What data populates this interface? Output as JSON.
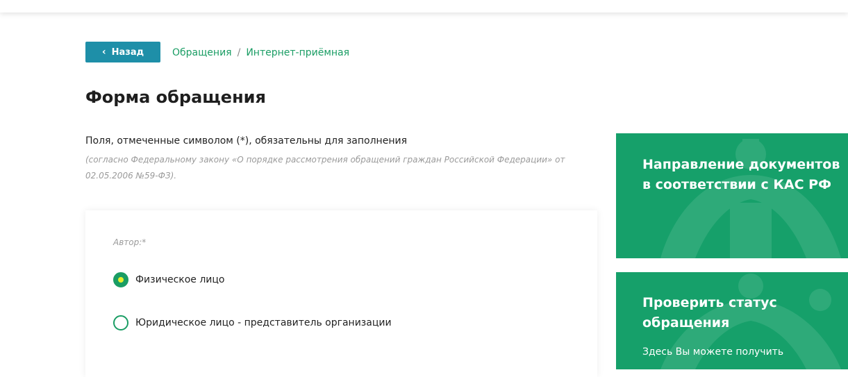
{
  "header": {},
  "nav": {
    "back_label": "Назад",
    "breadcrumb": [
      "Обращения",
      "Интернет-приёмная"
    ],
    "breadcrumb_separator": "/"
  },
  "page": {
    "title": "Форма обращения",
    "required_note": "Поля, отмеченные символом (*), обязательны для заполнения",
    "law_note": "(согласно Федеральному закону «О порядке рассмотрения обращений граждан Российской Федерации» от 02.05.2006 №59-ФЗ)."
  },
  "form": {
    "author_label": "Автор:*",
    "author_options": [
      {
        "label": "Физическое лицо",
        "checked": true
      },
      {
        "label": "Юридическое лицо - представитель организации",
        "checked": false
      }
    ]
  },
  "sidebar": {
    "cards": [
      {
        "title": "Направление документов в соответствии с КАС РФ"
      },
      {
        "title": "Проверить статус обращения",
        "text": "Здесь Вы можете получить"
      }
    ]
  },
  "colors": {
    "accent_green": "#16a06a",
    "button_blue": "#1e8fa8",
    "radio_dot": "#e6ef2c"
  }
}
